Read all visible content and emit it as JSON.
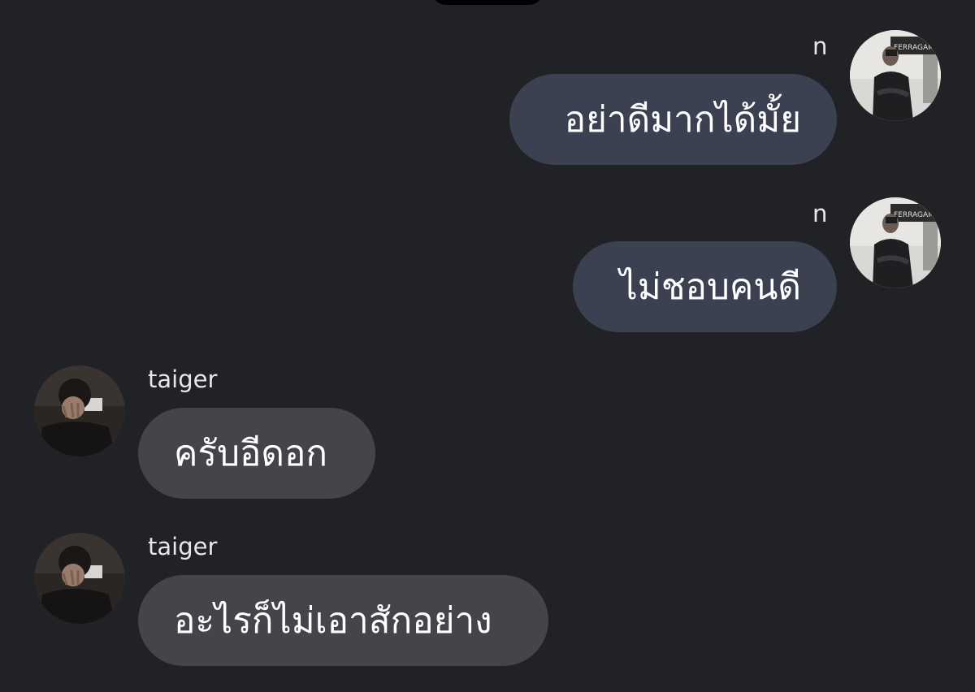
{
  "messages": [
    {
      "sender": "n",
      "text": "อย่าดีมากได้มั้ย",
      "direction": "outgoing",
      "avatar": "user-n-avatar"
    },
    {
      "sender": "n",
      "text": "ไม่ชอบคนดี",
      "direction": "outgoing",
      "avatar": "user-n-avatar"
    },
    {
      "sender": "taiger",
      "text": "ครับอีดอก",
      "direction": "incoming",
      "avatar": "user-taiger-avatar"
    },
    {
      "sender": "taiger",
      "text": "อะไรก็ไม่เอาสักอย่าง",
      "direction": "incoming",
      "avatar": "user-taiger-avatar"
    }
  ],
  "avatar_sign_text": "FERRAGAMO",
  "colors": {
    "background": "#212226",
    "sent_bubble": "#3b4151",
    "received_bubble": "#43454b",
    "text": "#ffffff",
    "name": "#e6e7ea"
  }
}
